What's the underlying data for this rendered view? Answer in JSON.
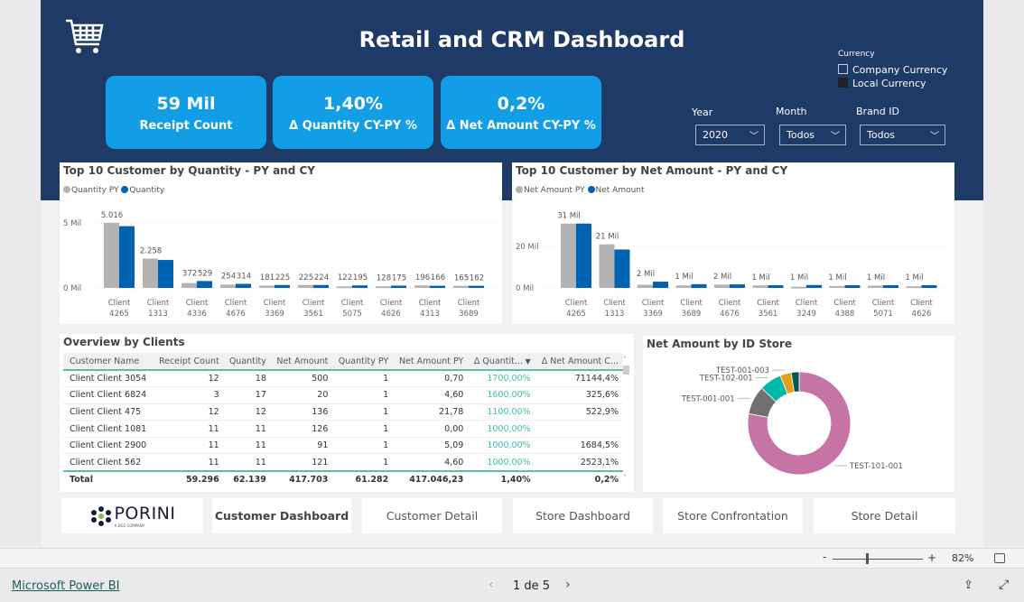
{
  "header": {
    "title": "Retail and CRM Dashboard",
    "icon": "shopping-cart-icon"
  },
  "kpis": [
    {
      "value": "59 Mil",
      "label": "Receipt Count"
    },
    {
      "value": "1,40%",
      "label": "Δ Quantity CY-PY %"
    },
    {
      "value": "0,2%",
      "label": "Δ Net Amount CY-PY %"
    }
  ],
  "currency": {
    "title": "Currency",
    "options": [
      {
        "label": "Company Currency",
        "checked": false
      },
      {
        "label": "Local Currency",
        "checked": true
      }
    ]
  },
  "filters": [
    {
      "label": "Year",
      "value": "2020"
    },
    {
      "label": "Month",
      "value": "Todos"
    },
    {
      "label": "Brand ID",
      "value": "Todos"
    }
  ],
  "colors": {
    "navy": "#1e3a66",
    "kpi": "#129ee6",
    "py": "#b3b3b3",
    "cy": "#0063b1",
    "teal": "#3fbfae"
  },
  "chart_data": [
    {
      "type": "bar",
      "title": "Top 10 Customer by Quantity - PY and CY",
      "series": [
        {
          "name": "Quantity PY",
          "values": [
            5016,
            2258,
            372,
            254,
            181,
            225,
            122,
            128,
            196,
            165
          ]
        },
        {
          "name": "Quantity",
          "values": [
            4750,
            2150,
            529,
            314,
            225,
            224,
            195,
            175,
            166,
            162
          ]
        }
      ],
      "categories": [
        [
          "Client",
          "4265"
        ],
        [
          "Client",
          "1313"
        ],
        [
          "Client",
          "4336"
        ],
        [
          "Client",
          "4676"
        ],
        [
          "Client",
          "3369"
        ],
        [
          "Client",
          "3561"
        ],
        [
          "Client",
          "5075"
        ],
        [
          "Client",
          "4626"
        ],
        [
          "Client",
          "4313"
        ],
        [
          "Client",
          "3689"
        ]
      ],
      "data_labels": [
        [
          "5.016",
          ""
        ],
        [
          "2.258",
          ""
        ],
        [
          "372",
          "529"
        ],
        [
          "254",
          "314"
        ],
        [
          "181",
          "225"
        ],
        [
          "225",
          "224"
        ],
        [
          "122",
          "195"
        ],
        [
          "128",
          "175"
        ],
        [
          "196",
          "166"
        ],
        [
          "165",
          "162"
        ]
      ],
      "yticks": [
        {
          "value": 0,
          "label": "0 Mil"
        },
        {
          "value": 5000,
          "label": "5 Mil"
        }
      ],
      "ylim": [
        0,
        5500
      ],
      "legend": "top-left"
    },
    {
      "type": "bar",
      "title": "Top 10 Customer by Net Amount  - PY and CY",
      "series": [
        {
          "name": "Net Amount PY",
          "values": [
            31,
            21,
            1.5,
            1.2,
            1.6,
            1.2,
            0.6,
            0.9,
            1.1,
            0.8
          ]
        },
        {
          "name": "Net Amount",
          "values": [
            31,
            18.5,
            3,
            1.8,
            1.7,
            1.3,
            1.4,
            1.3,
            1.3,
            1.3
          ]
        }
      ],
      "categories": [
        [
          "Client",
          "4265"
        ],
        [
          "Client",
          "1313"
        ],
        [
          "Client",
          "3369"
        ],
        [
          "Client",
          "3689"
        ],
        [
          "Client",
          "4676"
        ],
        [
          "Client",
          "3561"
        ],
        [
          "Client",
          "3249"
        ],
        [
          "Client",
          "4388"
        ],
        [
          "Client",
          "5071"
        ],
        [
          "Client",
          "4626"
        ]
      ],
      "data_labels": [
        "31 Mil",
        "21 Mil",
        "2 Mil",
        "1 Mil",
        "2 Mil",
        "1 Mil",
        "1 Mil",
        "1 Mil",
        "1 Mil",
        "1 Mil"
      ],
      "yticks": [
        {
          "value": 0,
          "label": "0 Mil"
        },
        {
          "value": 20,
          "label": "20 Mil"
        }
      ],
      "ylim": [
        0,
        33
      ],
      "legend": "top-left"
    },
    {
      "type": "pie",
      "title": "Net Amount by ID Store",
      "donut": true,
      "slices": [
        {
          "label": "TEST-101-001",
          "value": 78,
          "color": "#c674a6"
        },
        {
          "label": "TEST-001-001",
          "value": 9,
          "color": "#6f706f"
        },
        {
          "label": "TEST-102-001",
          "value": 7,
          "color": "#00b8aa"
        },
        {
          "label": "TEST-001-003",
          "value": 3.5,
          "color": "#e59f1e"
        },
        {
          "label": "",
          "value": 2.5,
          "color": "#005a52"
        }
      ]
    }
  ],
  "table": {
    "title": "Overview by Clients",
    "columns": [
      "Customer Name",
      "Receipt Count",
      "Quantity",
      "Net Amount",
      "Quantity PY",
      "Net Amount PY",
      "Δ Quantit...",
      "Δ Net Amount C..."
    ],
    "rows": [
      [
        "Client Client 3054",
        "12",
        "18",
        "500",
        "1",
        "0,70",
        "1700,00%",
        "71144,4%"
      ],
      [
        "Client Client 6824",
        "3",
        "17",
        "20",
        "1",
        "4,60",
        "1600,00%",
        "325,6%"
      ],
      [
        "Client Client 475",
        "12",
        "12",
        "136",
        "1",
        "21,78",
        "1100,00%",
        "522,9%"
      ],
      [
        "Client Client 1081",
        "11",
        "11",
        "126",
        "1",
        "0,00",
        "1000,00%",
        ""
      ],
      [
        "Client Client 2900",
        "11",
        "11",
        "91",
        "1",
        "5,09",
        "1000,00%",
        "1684,5%"
      ],
      [
        "Client Client 562",
        "11",
        "11",
        "121",
        "1",
        "4,60",
        "1000,00%",
        "2523,1%"
      ]
    ],
    "total": [
      "Total",
      "59.296",
      "62.139",
      "417.703",
      "61.282",
      "417.046,23",
      "1,40%",
      "0,2%"
    ]
  },
  "nav": {
    "logo": "PORINI",
    "logo_sub": "A DGS COMPANY",
    "buttons": [
      "Customer Dashboard",
      "Customer Detail",
      "Store Dashboard",
      "Store Confrontation",
      "Store Detail"
    ],
    "active": 0
  },
  "zoom": {
    "minus": "-",
    "plus": "+",
    "level": "82%",
    "value": 82
  },
  "footer": {
    "brand": "Microsoft Power BI",
    "page": "1 de 5"
  }
}
